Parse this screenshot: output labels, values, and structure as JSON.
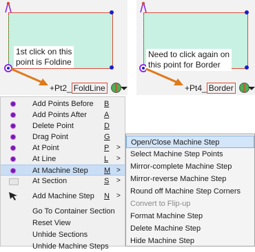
{
  "illustration": {
    "left_caption": [
      "1st click on this",
      "point is Foldine"
    ],
    "left_toolbar": {
      "prefix": "+Pt2_",
      "boxed": "FoldLine"
    },
    "right_caption": [
      "Need to click again on",
      "this point for Border"
    ],
    "right_toolbar": {
      "prefix": "+Pt4_",
      "boxed": "Border"
    },
    "icons": [
      "pin-icon",
      "globe-icon",
      "dropdown-arrow-icon",
      "orange-pointer-arrow"
    ]
  },
  "menu": {
    "items": [
      {
        "label": "Add Points Before",
        "key": "B",
        "icon": "point-icon"
      },
      {
        "label": "Add Points After",
        "key": "A",
        "icon": "point-icon"
      },
      {
        "label": "Delete Point",
        "key": "D",
        "icon": "point-icon"
      },
      {
        "label": "Drag Point",
        "key": "G",
        "icon": "point-icon"
      },
      {
        "label": "At Point",
        "key": "P",
        "arrow": ">",
        "icon": "point-icon"
      },
      {
        "label": "At Line",
        "key": "L",
        "arrow": ">",
        "icon": "point-icon"
      },
      {
        "label": "At Machine Step",
        "key": "M",
        "arrow": ">",
        "icon": "point-icon",
        "selected": true
      },
      {
        "label": "At Section",
        "key": "S",
        "arrow": ">",
        "icon": "section-icon"
      },
      {
        "label": "Add Machine Step",
        "key": "N",
        "arrow": ">",
        "icon": "cursor-icon"
      },
      {
        "label": "Go To Container Section"
      },
      {
        "label": "Reset View"
      },
      {
        "label": "Unhide Sections"
      },
      {
        "label": "Unhide Machine Steps"
      }
    ]
  },
  "submenu": {
    "items": [
      {
        "label": "Open/Close Machine Step",
        "highlighted": true
      },
      {
        "label": "Select Machine Step Points"
      },
      {
        "label": "Mirror-complete Machine Step"
      },
      {
        "label": "Mirror-reverse Machine Step"
      },
      {
        "label": "Round off Machine Step Corners"
      },
      {
        "label": "Convert to Flip-up",
        "disabled": true
      },
      {
        "label": "Format Machine Step"
      },
      {
        "label": "Delete Machine Step"
      },
      {
        "label": "Hide Machine Step"
      }
    ]
  },
  "colors": {
    "shape_fill": "#c8f1e3",
    "shape_border": "#d94a36",
    "fold_line": "#3cb34a",
    "pointer_arrow": "#e07a1a",
    "menu_selected": "#c9def5",
    "submenu_highlight": "#d3e5f8"
  }
}
